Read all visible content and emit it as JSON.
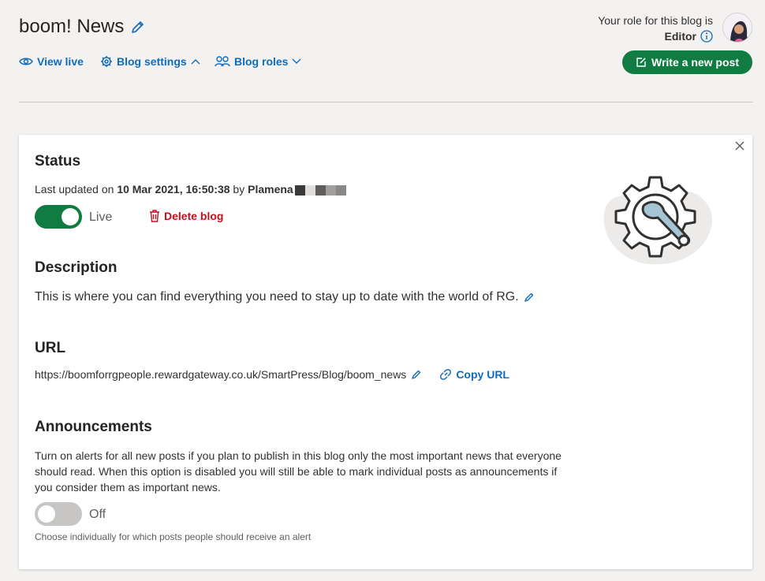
{
  "header": {
    "title": "boom! News",
    "nav": {
      "view_live": "View live",
      "blog_settings": "Blog settings",
      "blog_roles": "Blog roles"
    },
    "role_line1": "Your role for this blog is",
    "role_value": "Editor",
    "write_button": "Write a new post"
  },
  "status": {
    "heading": "Status",
    "last_updated_prefix": "Last updated on",
    "last_updated_date": "10 Mar 2021, 16:50:38",
    "by": "by",
    "author": "Plamena",
    "toggle_label": "Live",
    "delete_label": "Delete blog"
  },
  "description": {
    "heading": "Description",
    "text": "This is where you can find everything you need to stay up to date with the world of RG."
  },
  "url": {
    "heading": "URL",
    "value": "https://boomforrgpeople.rewardgateway.co.uk/SmartPress/Blog/boom_news",
    "copy_label": "Copy URL"
  },
  "announcements": {
    "heading": "Announcements",
    "line1": "Turn on alerts for all new posts if you plan to publish in this blog only the most important news that everyone",
    "line2": "should read. When this option is disabled you will still be able to mark individual posts as announcements if",
    "line3": "you consider them as important news.",
    "toggle_label": "Off",
    "hint": "Choose individually for which posts people should receive an alert"
  },
  "colors": {
    "accent": "#0f6cbd",
    "brand_green": "#107c41",
    "danger": "#c50f1f"
  }
}
